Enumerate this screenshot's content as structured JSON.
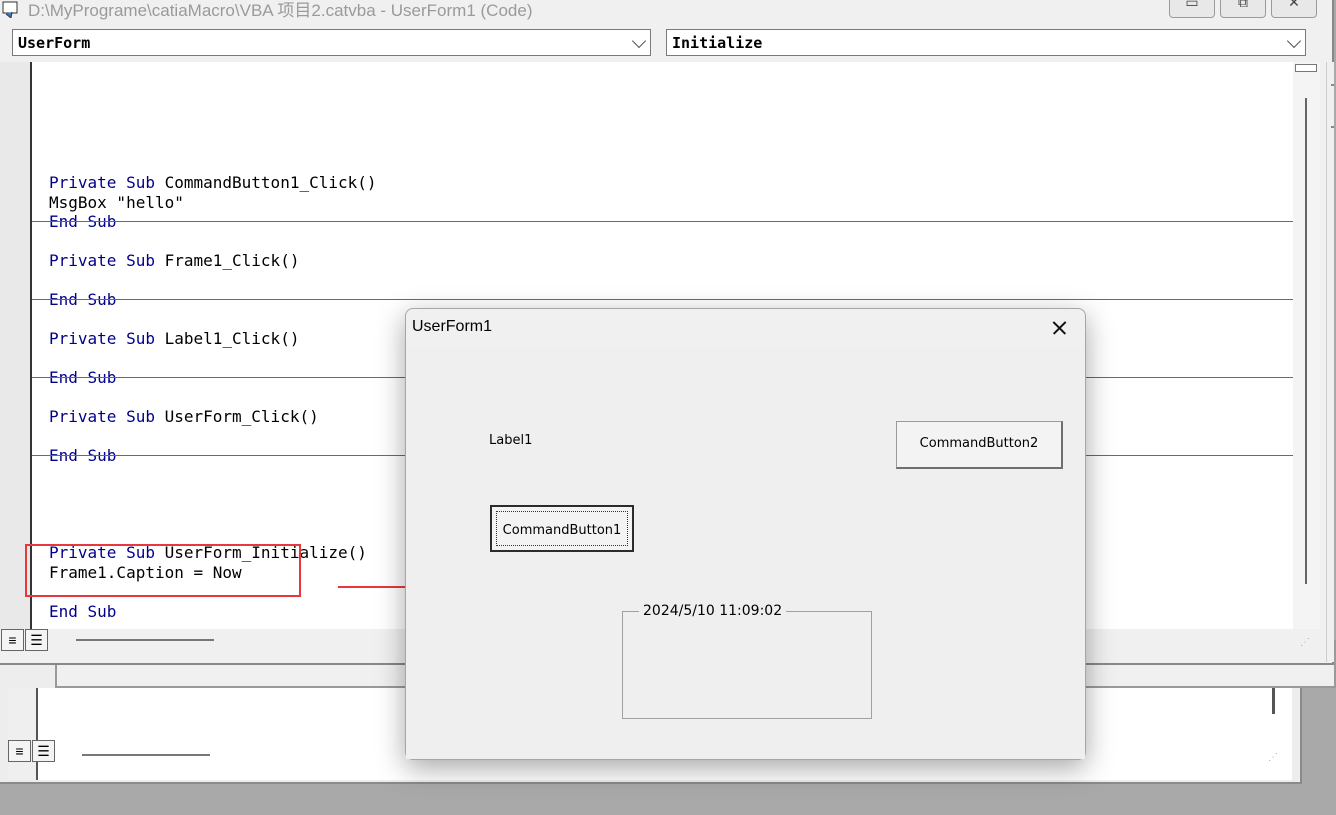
{
  "window": {
    "title": "D:\\MyPrograme\\catiaMacro\\VBA 项目2.catvba - UserForm1 (Code)",
    "minimize_glyph": "▭",
    "restore_glyph": "⧉",
    "close_glyph": "✕"
  },
  "toolbar": {
    "object_combo": "UserForm",
    "procedure_combo": "Initialize"
  },
  "code": {
    "blocks": [
      {
        "lines": [
          {
            "kw": "Private Sub ",
            "text": "CommandButton1_Click()"
          },
          {
            "kw": "",
            "text": "MsgBox \"hello\""
          },
          {
            "kw": "End Sub",
            "text": ""
          }
        ]
      },
      {
        "lines": [
          {
            "kw": "Private Sub ",
            "text": "Frame1_Click()"
          },
          {
            "kw": "",
            "text": ""
          },
          {
            "kw": "End Sub",
            "text": ""
          }
        ]
      },
      {
        "lines": [
          {
            "kw": "Private Sub ",
            "text": "Label1_Click()"
          },
          {
            "kw": "",
            "text": ""
          },
          {
            "kw": "End Sub",
            "text": ""
          }
        ]
      },
      {
        "lines": [
          {
            "kw": "Private Sub ",
            "text": "UserForm_Click()"
          },
          {
            "kw": "",
            "text": ""
          },
          {
            "kw": "End Sub",
            "text": ""
          }
        ]
      },
      {
        "lines": [
          {
            "kw": "Private Sub ",
            "text": "UserForm_Initialize()"
          },
          {
            "kw": "",
            "text": "Frame1.Caption = Now"
          },
          {
            "kw": "",
            "text": ""
          },
          {
            "kw": "End Sub",
            "text": ""
          }
        ]
      }
    ]
  },
  "view_buttons": {
    "procedure_view": "≡",
    "full_module_view": "☰"
  },
  "dialog": {
    "title": "UserForm1",
    "label1": "Label1",
    "command_button1": "CommandButton1",
    "command_button2": "CommandButton2",
    "frame1_caption": "2024/5/10 11:09:02"
  },
  "annotation": {
    "highlight_color": "#e8383d"
  },
  "colors": {
    "keyword": "#00008b",
    "editor_background": "#ffffff",
    "dialog_background": "#efefef"
  }
}
